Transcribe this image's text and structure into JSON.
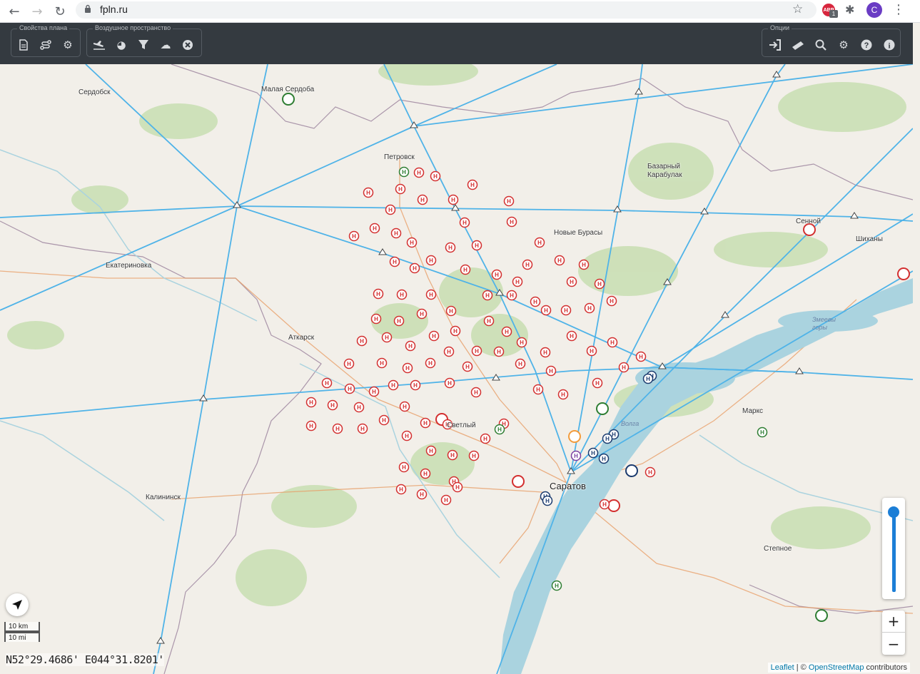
{
  "browser": {
    "url": "fpln.ru",
    "abp_badge": "ABP",
    "abp_count": "1",
    "profile_initial": "C"
  },
  "toolbar": {
    "groups": [
      {
        "label": "Свойства плана",
        "icons": [
          "document-icon",
          "route-icon",
          "settings-cogs-icon"
        ]
      },
      {
        "label": "Воздушное пространство",
        "icons": [
          "aircraft-landing-icon",
          "pie-chart-icon",
          "filter-icon",
          "weather-cloud-icon",
          "close-circle-icon"
        ]
      },
      {
        "label": "Опции",
        "icons": [
          "sign-in-icon",
          "ruler-icon",
          "search-icon",
          "gear-icon",
          "help-icon",
          "info-icon"
        ]
      }
    ]
  },
  "map": {
    "cities": [
      {
        "name": "Сердобск"
      },
      {
        "name": "Малая Сердоба"
      },
      {
        "name": "Петровск"
      },
      {
        "name": "Базарный\nКарабулак"
      },
      {
        "name": "Новые Бурасы"
      },
      {
        "name": "Сенной"
      },
      {
        "name": "Шиханы"
      },
      {
        "name": "Екатериновка"
      },
      {
        "name": "Аткарск"
      },
      {
        "name": "Светлый"
      },
      {
        "name": "Маркс"
      },
      {
        "name": "Калининск"
      },
      {
        "name": "Саратов"
      },
      {
        "name": "Степное"
      },
      {
        "name": "Волга"
      },
      {
        "name": "Змеевы\nгоры"
      }
    ],
    "heliport_symbol": "H",
    "coordinates": "N52°29.4686' E044°31.8201'",
    "scale": {
      "km": "10 km",
      "mi": "10 mi"
    },
    "zoom_level_fraction": 0.95,
    "zoom_in": "+",
    "zoom_out": "−",
    "attribution": {
      "leaflet": "Leaflet",
      "sep": " | © ",
      "osm": "OpenStreetMap",
      "rest": " contributors"
    }
  },
  "colors": {
    "toolbar_bg": "#343a40",
    "airway": "#4fb3e8",
    "heliport": "#d32f2f",
    "airfield_green": "#2e7d32",
    "airfield_navy": "#1a3a6e",
    "river": "#aad3df",
    "forest": "#c8deb1"
  }
}
